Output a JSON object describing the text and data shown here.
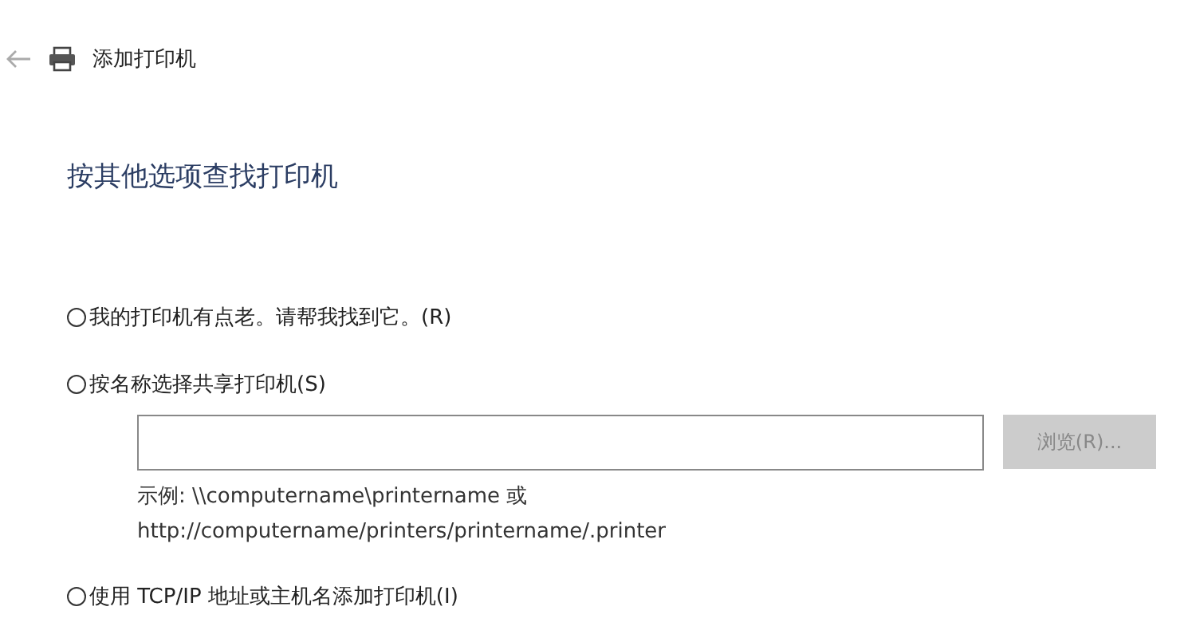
{
  "window": {
    "title": "添加打印机"
  },
  "heading": "按其他选项查找打印机",
  "options": [
    {
      "label": "我的打印机有点老。请帮我找到它。(R)",
      "selected": false
    },
    {
      "label": "按名称选择共享打印机(S)",
      "selected": false,
      "share_field": {
        "browse_button": {
          "label": "浏览(R)...",
          "disabled": true
        },
        "example_lines": [
          "示例: \\\\computername\\printername 或",
          "http://computername/printers/printername/.printer"
        ]
      }
    },
    {
      "label": "使用 TCP/IP 地址或主机名添加打印机(I)",
      "selected": false
    }
  ]
}
